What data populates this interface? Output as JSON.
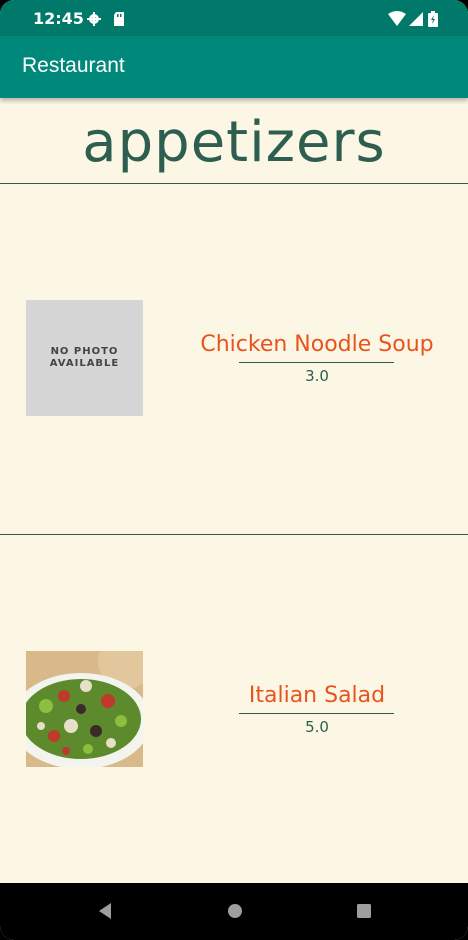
{
  "status_bar": {
    "time": "12:45",
    "icons": [
      "gear-icon",
      "sd-card-icon",
      "wifi-icon",
      "signal-icon",
      "battery-icon"
    ]
  },
  "app_bar": {
    "title": "Restaurant"
  },
  "category": {
    "title": "appetizers"
  },
  "items": [
    {
      "name": "Chicken Noodle Soup",
      "price": "3.0",
      "image": "no-photo",
      "placeholder_text": "NO PHOTO AVAILABLE"
    },
    {
      "name": "Italian Salad",
      "price": "5.0",
      "image": "salad-photo"
    }
  ],
  "nav_bar": {
    "buttons": [
      "back-icon",
      "home-icon",
      "recents-icon"
    ]
  },
  "colors": {
    "status_bar": "#00796b",
    "app_bar": "#00897b",
    "background": "#fcf6e4",
    "title": "#2e5e50",
    "item_name": "#e8531e"
  }
}
